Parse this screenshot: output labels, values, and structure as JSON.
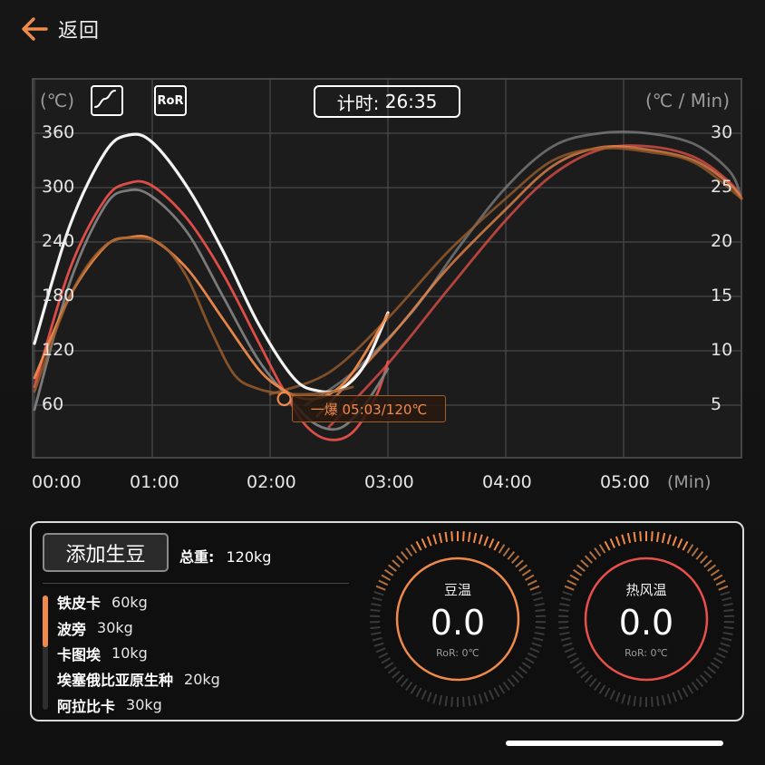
{
  "nav": {
    "back_label": "返回"
  },
  "chart": {
    "unit_left": "(℃)",
    "unit_right": "(℃ / Min)",
    "timer_label": "计时:",
    "timer_value": "26:35",
    "ror_button": "RoR",
    "x_unit": "(Min)",
    "annotation": "一爆 05:03/120℃"
  },
  "chart_data": {
    "type": "line",
    "x_ticks": [
      "00:00",
      "01:00",
      "02:00",
      "03:00",
      "04:00",
      "05:00"
    ],
    "y_left_ticks": [
      "360",
      "300",
      "240",
      "180",
      "120",
      "60"
    ],
    "y_right_ticks": [
      "30",
      "25",
      "20",
      "15",
      "10",
      "5"
    ],
    "ylim_left": [
      0,
      360
    ],
    "ylim_right": [
      0,
      30
    ],
    "xlim": [
      0,
      6
    ],
    "grid": true,
    "colors": {
      "white": "#ffffff",
      "red": "#e8504a",
      "orange": "#f08a4b",
      "gray": "#808080",
      "brown": "#a0602e"
    },
    "series": [
      {
        "color": "white",
        "axis": "left",
        "points": [
          [
            0.0,
            128
          ],
          [
            0.3,
            258
          ],
          [
            0.6,
            339
          ],
          [
            0.8,
            358
          ],
          [
            1.0,
            350
          ],
          [
            1.3,
            300
          ],
          [
            1.6,
            230
          ],
          [
            1.9,
            150
          ],
          [
            2.2,
            90
          ],
          [
            2.4,
            76
          ],
          [
            2.6,
            78
          ],
          [
            2.8,
            104
          ],
          [
            3.0,
            162
          ]
        ]
      },
      {
        "color": "red",
        "axis": "left",
        "points": [
          [
            0.0,
            80
          ],
          [
            0.3,
            210
          ],
          [
            0.6,
            287
          ],
          [
            0.8,
            305
          ],
          [
            1.0,
            302
          ],
          [
            1.3,
            265
          ],
          [
            1.6,
            205
          ],
          [
            1.9,
            130
          ],
          [
            2.1,
            80
          ],
          [
            2.3,
            38
          ],
          [
            2.5,
            22
          ],
          [
            2.7,
            30
          ],
          [
            2.9,
            70
          ],
          [
            3.0,
            108
          ]
        ]
      },
      {
        "color": "gray",
        "axis": "left",
        "points": [
          [
            0.0,
            55
          ],
          [
            0.3,
            195
          ],
          [
            0.6,
            280
          ],
          [
            0.8,
            297
          ],
          [
            1.0,
            290
          ],
          [
            1.3,
            250
          ],
          [
            1.6,
            180
          ],
          [
            1.9,
            110
          ],
          [
            2.2,
            62
          ],
          [
            2.4,
            38
          ],
          [
            2.6,
            35
          ],
          [
            2.8,
            60
          ],
          [
            3.0,
            100
          ]
        ]
      },
      {
        "color": "orange",
        "axis": "left",
        "points": [
          [
            0.0,
            90
          ],
          [
            0.3,
            180
          ],
          [
            0.6,
            235
          ],
          [
            0.8,
            245
          ],
          [
            1.0,
            243
          ],
          [
            1.3,
            210
          ],
          [
            1.6,
            155
          ],
          [
            1.9,
            100
          ],
          [
            2.1,
            78
          ],
          [
            2.3,
            67
          ],
          [
            2.5,
            72
          ],
          [
            2.7,
            96
          ],
          [
            3.0,
            160
          ]
        ]
      },
      {
        "color": "brown",
        "axis": "left",
        "points": [
          [
            0.0,
            75
          ],
          [
            0.3,
            180
          ],
          [
            0.6,
            236
          ],
          [
            0.9,
            244
          ],
          [
            1.1,
            235
          ],
          [
            1.3,
            200
          ],
          [
            1.5,
            142
          ],
          [
            1.7,
            93
          ],
          [
            1.9,
            78
          ],
          [
            2.1,
            73
          ],
          [
            2.3,
            72
          ],
          [
            2.5,
            74
          ],
          [
            2.7,
            80
          ]
        ]
      },
      {
        "color": "gray",
        "axis": "right",
        "points": [
          [
            2.3,
            5.0
          ],
          [
            2.7,
            8.0
          ],
          [
            3.2,
            13.5
          ],
          [
            3.6,
            19.5
          ],
          [
            4.0,
            25.0
          ],
          [
            4.4,
            28.8
          ],
          [
            4.8,
            30.0
          ],
          [
            5.2,
            30.0
          ],
          [
            5.6,
            29.0
          ],
          [
            5.9,
            26.5
          ],
          [
            6.0,
            24.0
          ]
        ]
      },
      {
        "color": "red",
        "axis": "right",
        "points": [
          [
            2.5,
            3.0
          ],
          [
            3.0,
            8.8
          ],
          [
            3.5,
            15.5
          ],
          [
            4.0,
            22.0
          ],
          [
            4.4,
            26.2
          ],
          [
            4.8,
            28.5
          ],
          [
            5.2,
            28.8
          ],
          [
            5.6,
            27.8
          ],
          [
            5.9,
            25.5
          ],
          [
            6.0,
            24.0
          ]
        ]
      },
      {
        "color": "orange",
        "axis": "right",
        "points": [
          [
            2.4,
            4.0
          ],
          [
            3.0,
            11.0
          ],
          [
            3.5,
            17.5
          ],
          [
            4.0,
            23.0
          ],
          [
            4.4,
            27.0
          ],
          [
            4.8,
            28.7
          ],
          [
            5.2,
            28.5
          ],
          [
            5.6,
            27.5
          ],
          [
            5.9,
            25.3
          ],
          [
            6.0,
            24.0
          ]
        ]
      },
      {
        "color": "brown",
        "axis": "right",
        "points": [
          [
            2.0,
            6.0
          ],
          [
            2.5,
            8.0
          ],
          [
            3.0,
            13.0
          ],
          [
            3.5,
            19.0
          ],
          [
            4.0,
            24.0
          ],
          [
            4.4,
            27.5
          ],
          [
            4.8,
            28.6
          ],
          [
            5.2,
            28.3
          ],
          [
            5.6,
            27.3
          ],
          [
            6.0,
            24.0
          ]
        ]
      }
    ],
    "marker": {
      "x": 2.12,
      "y": 67,
      "axis": "left"
    }
  },
  "beans": {
    "add_button": "添加生豆",
    "total_label": "总重:",
    "total_value": "120kg",
    "scroll_fraction": 0.45,
    "items": [
      {
        "name": "铁皮卡",
        "weight": "60kg"
      },
      {
        "name": "波旁",
        "weight": "30kg"
      },
      {
        "name": "卡图埃",
        "weight": "10kg"
      },
      {
        "name": "埃塞俄比亚原生种",
        "weight": "20kg"
      },
      {
        "name": "阿拉比卡",
        "weight": "30kg"
      }
    ]
  },
  "gauges": [
    {
      "title": "豆温",
      "value": "0.0",
      "ror": "RoR: 0℃"
    },
    {
      "title": "热风温",
      "value": "0.0",
      "ror": "RoR: 0℃"
    }
  ]
}
